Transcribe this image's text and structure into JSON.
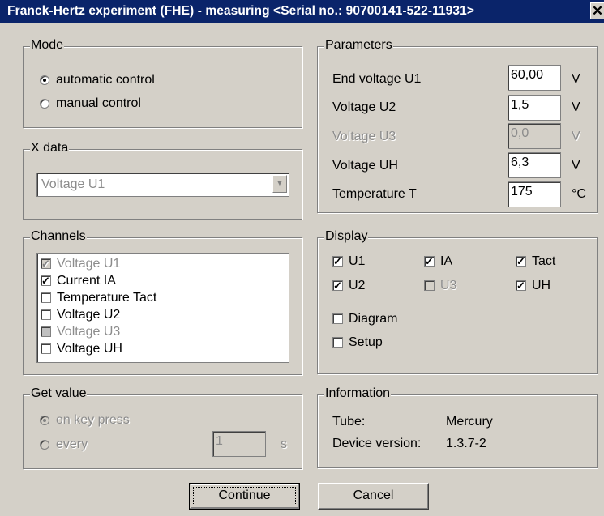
{
  "window": {
    "title": "Franck-Hertz experiment (FHE) - measuring  <Serial no.: 90700141-522-11931>",
    "close_label": "✕"
  },
  "mode": {
    "legend": "Mode",
    "options": [
      {
        "label": "automatic control",
        "checked": true
      },
      {
        "label": "manual control",
        "checked": false
      }
    ]
  },
  "xdata": {
    "legend": "X data",
    "selected": "Voltage U1"
  },
  "channels": {
    "legend": "Channels",
    "items": [
      {
        "label": "Voltage U1",
        "checked": true,
        "enabled": false
      },
      {
        "label": "Current IA",
        "checked": true,
        "enabled": true
      },
      {
        "label": "Temperature Tact",
        "checked": false,
        "enabled": true
      },
      {
        "label": "Voltage U2",
        "checked": false,
        "enabled": true
      },
      {
        "label": "Voltage U3",
        "checked": false,
        "enabled": false
      },
      {
        "label": "Voltage UH",
        "checked": false,
        "enabled": true
      }
    ]
  },
  "getvalue": {
    "legend": "Get value",
    "on_key_press": "on key press",
    "every": "every",
    "interval": "1",
    "unit": "s"
  },
  "parameters": {
    "legend": "Parameters",
    "rows": [
      {
        "label": "End voltage U1",
        "value": "60,00",
        "unit": "V",
        "enabled": true
      },
      {
        "label": "Voltage U2",
        "value": "1,5",
        "unit": "V",
        "enabled": true
      },
      {
        "label": "Voltage U3",
        "value": "0,0",
        "unit": "V",
        "enabled": false
      },
      {
        "label": "Voltage UH",
        "value": "6,3",
        "unit": "V",
        "enabled": true
      },
      {
        "label": "Temperature T",
        "value": "175",
        "unit": "°C",
        "enabled": true
      }
    ]
  },
  "display": {
    "legend": "Display",
    "checks": [
      {
        "label": "U1",
        "checked": true,
        "enabled": true
      },
      {
        "label": "IA",
        "checked": true,
        "enabled": true
      },
      {
        "label": "Tact",
        "checked": true,
        "enabled": true
      },
      {
        "label": "U2",
        "checked": true,
        "enabled": true
      },
      {
        "label": "U3",
        "checked": false,
        "enabled": false
      },
      {
        "label": "UH",
        "checked": true,
        "enabled": true
      }
    ],
    "diagram": {
      "label": "Diagram",
      "checked": false
    },
    "setup": {
      "label": "Setup",
      "checked": false
    }
  },
  "information": {
    "legend": "Information",
    "tube_label": "Tube:",
    "tube_value": "Mercury",
    "version_label": "Device version:",
    "version_value": "1.3.7-2"
  },
  "buttons": {
    "continue": "Continue",
    "cancel": "Cancel"
  }
}
